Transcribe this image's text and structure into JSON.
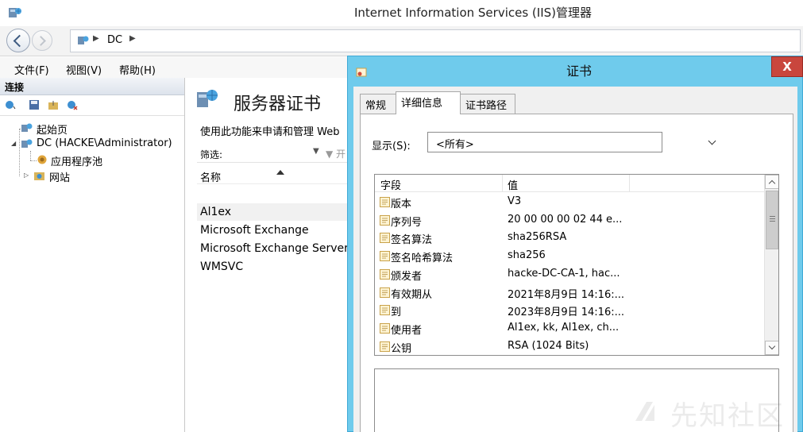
{
  "window": {
    "title": "Internet Information Services (IIS)管理器"
  },
  "address": {
    "segments": [
      "DC"
    ]
  },
  "menu": [
    "文件(F)",
    "视图(V)",
    "帮助(H)"
  ],
  "connections": {
    "header": "连接",
    "tree": [
      {
        "label": "起始页"
      },
      {
        "label": "DC (HACKE\\Administrator)"
      },
      {
        "label": "应用程序池"
      },
      {
        "label": "网站"
      }
    ]
  },
  "content": {
    "title": "服务器证书",
    "description": "使用此功能来申请和管理 Web",
    "filter_label": "筛选:",
    "filter_go": "开",
    "column_name": "名称",
    "rows": [
      "Al1ex",
      "Microsoft Exchange",
      "Microsoft Exchange Server",
      "WMSVC"
    ]
  },
  "dialog": {
    "title": "证书",
    "close_label": "X",
    "tabs": [
      "常规",
      "详细信息",
      "证书路径"
    ],
    "active_tab": 1,
    "show_label": "显示(S):",
    "show_value": "<所有>",
    "fields_header": {
      "field": "字段",
      "value": "值"
    },
    "fields": [
      {
        "name": "版本",
        "value": "V3"
      },
      {
        "name": "序列号",
        "value": "20 00 00 00 02 44 e..."
      },
      {
        "name": "签名算法",
        "value": "sha256RSA"
      },
      {
        "name": "签名哈希算法",
        "value": "sha256"
      },
      {
        "name": "颁发者",
        "value": "hacke-DC-CA-1, hac..."
      },
      {
        "name": "有效期从",
        "value": "2021年8月9日 14:16:..."
      },
      {
        "name": "到",
        "value": "2023年8月9日 14:16:..."
      },
      {
        "name": "使用者",
        "value": "Al1ex, kk, Al1ex, ch..."
      },
      {
        "name": "公钥",
        "value": "RSA (1024 Bits)"
      }
    ]
  },
  "watermark": "先知社区",
  "colors": {
    "dialog_frame": "#6fcbec",
    "close_button": "#c9463d"
  }
}
